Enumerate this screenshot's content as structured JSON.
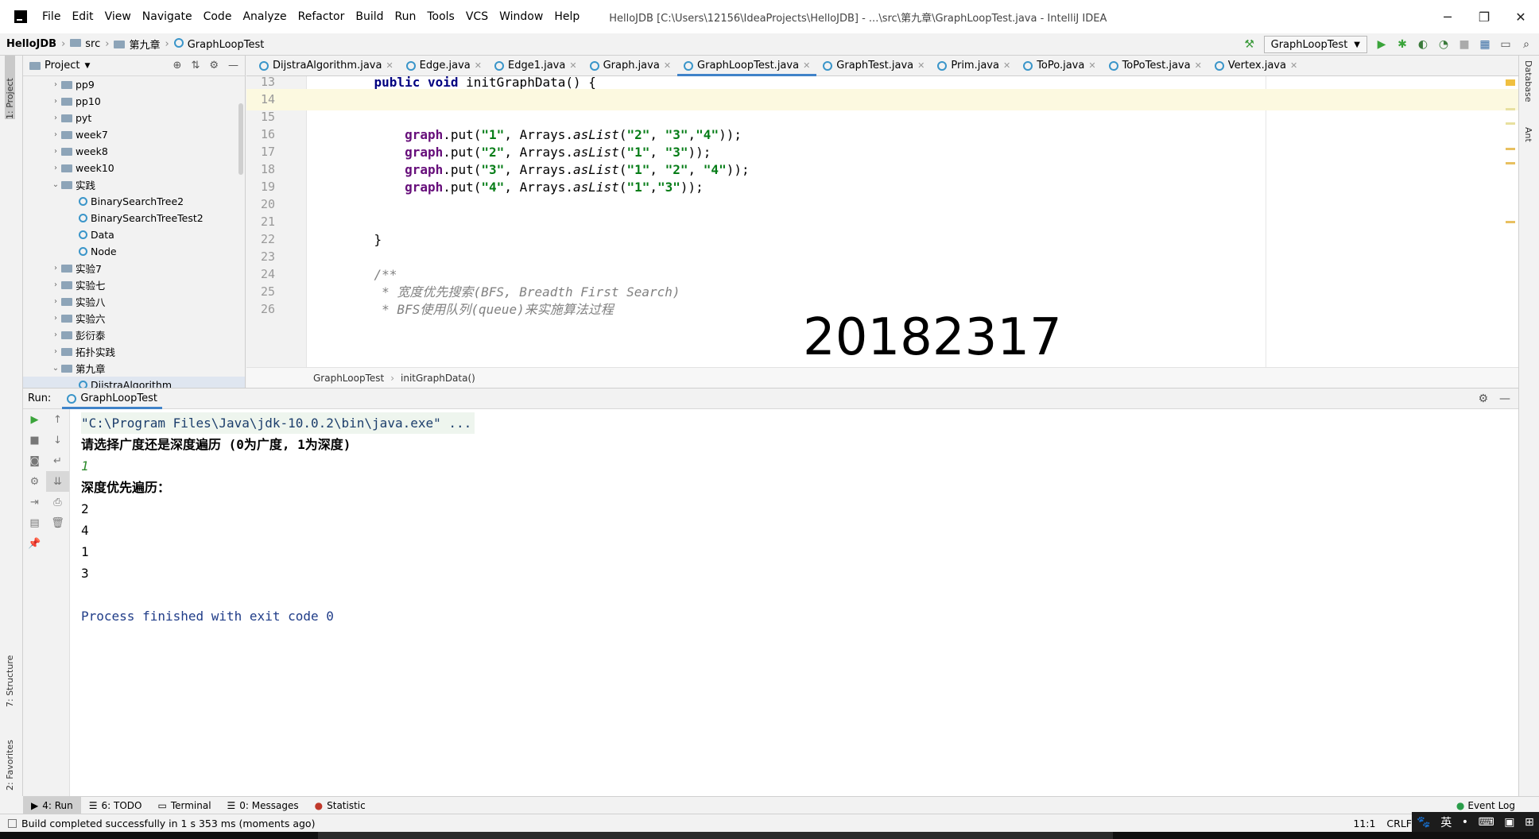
{
  "window": {
    "title": "HelloJDB [C:\\Users\\12156\\IdeaProjects\\HelloJDB] - ...\\src\\第九章\\GraphLoopTest.java - IntelliJ IDEA",
    "minimize": "─",
    "restore": "❐",
    "close": "✕"
  },
  "menu": [
    "File",
    "Edit",
    "View",
    "Navigate",
    "Code",
    "Analyze",
    "Refactor",
    "Build",
    "Run",
    "Tools",
    "VCS",
    "Window",
    "Help"
  ],
  "breadcrumb": [
    "HelloJDB",
    "src",
    "第九章",
    "GraphLoopTest"
  ],
  "run_config": "GraphLoopTest",
  "left_tabs": [
    "1: Project",
    "7: Structure",
    "2: Favorites"
  ],
  "right_tabs": [
    "Database",
    "Ant"
  ],
  "project_panel": {
    "title": "Project",
    "items": [
      {
        "label": "pp9",
        "kind": "folder",
        "expanded": false,
        "indent": 1
      },
      {
        "label": "pp10",
        "kind": "folder",
        "expanded": false,
        "indent": 1
      },
      {
        "label": "pyt",
        "kind": "folder",
        "expanded": false,
        "indent": 1
      },
      {
        "label": "week7",
        "kind": "folder",
        "expanded": false,
        "indent": 1
      },
      {
        "label": "week8",
        "kind": "folder",
        "expanded": false,
        "indent": 1
      },
      {
        "label": "week10",
        "kind": "folder",
        "expanded": false,
        "indent": 1
      },
      {
        "label": "实践",
        "kind": "folder",
        "expanded": true,
        "indent": 1
      },
      {
        "label": "BinarySearchTree2",
        "kind": "class",
        "indent": 2
      },
      {
        "label": "BinarySearchTreeTest2",
        "kind": "class",
        "indent": 2
      },
      {
        "label": "Data",
        "kind": "class",
        "indent": 2
      },
      {
        "label": "Node",
        "kind": "class",
        "indent": 2
      },
      {
        "label": "实验7",
        "kind": "folder",
        "expanded": false,
        "indent": 1
      },
      {
        "label": "实验七",
        "kind": "folder",
        "expanded": false,
        "indent": 1
      },
      {
        "label": "实验八",
        "kind": "folder",
        "expanded": false,
        "indent": 1
      },
      {
        "label": "实验六",
        "kind": "folder",
        "expanded": false,
        "indent": 1
      },
      {
        "label": "彭衍泰",
        "kind": "folder",
        "expanded": false,
        "indent": 1
      },
      {
        "label": "拓扑实践",
        "kind": "folder",
        "expanded": false,
        "indent": 1
      },
      {
        "label": "第九章",
        "kind": "folder",
        "expanded": true,
        "indent": 1
      },
      {
        "label": "DijstraAlgorithm",
        "kind": "class",
        "indent": 2
      }
    ]
  },
  "tabs": [
    {
      "label": "DijstraAlgorithm.java",
      "active": false
    },
    {
      "label": "Edge.java",
      "active": false
    },
    {
      "label": "Edge1.java",
      "active": false
    },
    {
      "label": "Graph.java",
      "active": false
    },
    {
      "label": "GraphLoopTest.java",
      "active": true
    },
    {
      "label": "GraphTest.java",
      "active": false
    },
    {
      "label": "Prim.java",
      "active": false
    },
    {
      "label": "ToPo.java",
      "active": false
    },
    {
      "label": "ToPoTest.java",
      "active": false
    },
    {
      "label": "Vertex.java",
      "active": false
    }
  ],
  "code_lines": [
    {
      "num": "13",
      "segments": [
        {
          "t": "    ",
          "c": ""
        },
        {
          "t": "public void ",
          "c": "kw"
        },
        {
          "t": "initGraphData() {",
          "c": ""
        }
      ]
    },
    {
      "num": "14",
      "current": true,
      "segments": []
    },
    {
      "num": "15",
      "segments": []
    },
    {
      "num": "16",
      "segments": [
        {
          "t": "        ",
          "c": ""
        },
        {
          "t": "graph",
          "c": "fld"
        },
        {
          "t": ".put(",
          "c": ""
        },
        {
          "t": "\"1\"",
          "c": "str"
        },
        {
          "t": ", Arrays.",
          "c": ""
        },
        {
          "t": "asList",
          "c": "it"
        },
        {
          "t": "(",
          "c": ""
        },
        {
          "t": "\"2\"",
          "c": "str"
        },
        {
          "t": ", ",
          "c": ""
        },
        {
          "t": "\"3\"",
          "c": "str"
        },
        {
          "t": ",",
          "c": ""
        },
        {
          "t": "\"4\"",
          "c": "str"
        },
        {
          "t": "));",
          "c": ""
        }
      ]
    },
    {
      "num": "17",
      "segments": [
        {
          "t": "        ",
          "c": ""
        },
        {
          "t": "graph",
          "c": "fld"
        },
        {
          "t": ".put(",
          "c": ""
        },
        {
          "t": "\"2\"",
          "c": "str"
        },
        {
          "t": ", Arrays.",
          "c": ""
        },
        {
          "t": "asList",
          "c": "it"
        },
        {
          "t": "(",
          "c": ""
        },
        {
          "t": "\"1\"",
          "c": "str"
        },
        {
          "t": ", ",
          "c": ""
        },
        {
          "t": "\"3\"",
          "c": "str"
        },
        {
          "t": "));",
          "c": ""
        }
      ]
    },
    {
      "num": "18",
      "segments": [
        {
          "t": "        ",
          "c": ""
        },
        {
          "t": "graph",
          "c": "fld"
        },
        {
          "t": ".put(",
          "c": ""
        },
        {
          "t": "\"3\"",
          "c": "str"
        },
        {
          "t": ", Arrays.",
          "c": ""
        },
        {
          "t": "asList",
          "c": "it"
        },
        {
          "t": "(",
          "c": ""
        },
        {
          "t": "\"1\"",
          "c": "str"
        },
        {
          "t": ", ",
          "c": ""
        },
        {
          "t": "\"2\"",
          "c": "str"
        },
        {
          "t": ", ",
          "c": ""
        },
        {
          "t": "\"4\"",
          "c": "str"
        },
        {
          "t": "));",
          "c": ""
        }
      ]
    },
    {
      "num": "19",
      "segments": [
        {
          "t": "        ",
          "c": ""
        },
        {
          "t": "graph",
          "c": "fld"
        },
        {
          "t": ".put(",
          "c": ""
        },
        {
          "t": "\"4\"",
          "c": "str"
        },
        {
          "t": ", Arrays.",
          "c": ""
        },
        {
          "t": "asList",
          "c": "it"
        },
        {
          "t": "(",
          "c": ""
        },
        {
          "t": "\"1\"",
          "c": "str"
        },
        {
          "t": ",",
          "c": ""
        },
        {
          "t": "\"3\"",
          "c": "str"
        },
        {
          "t": "));",
          "c": ""
        }
      ]
    },
    {
      "num": "20",
      "segments": []
    },
    {
      "num": "21",
      "segments": []
    },
    {
      "num": "22",
      "segments": [
        {
          "t": "    }",
          "c": ""
        }
      ]
    },
    {
      "num": "23",
      "segments": []
    },
    {
      "num": "24",
      "segments": [
        {
          "t": "    /**",
          "c": "cmt"
        }
      ]
    },
    {
      "num": "25",
      "segments": [
        {
          "t": "     * 宽度优先搜索(BFS, Breadth First Search)",
          "c": "cmt"
        }
      ]
    },
    {
      "num": "26",
      "segments": [
        {
          "t": "     * BFS使用队列(queue)来实施算法过程",
          "c": "cmt"
        }
      ]
    }
  ],
  "watermark": "20182317",
  "editor_breadcrumb": [
    "GraphLoopTest",
    "initGraphData()"
  ],
  "run": {
    "label": "Run:",
    "tab": "GraphLoopTest",
    "console": [
      {
        "text": "\"C:\\Program Files\\Java\\jdk-10.0.2\\bin\\java.exe\" ...",
        "style": "cmd"
      },
      {
        "text": "请选择广度还是深度遍历 (0为广度, 1为深度)",
        "style": "bold"
      },
      {
        "text": "1",
        "style": "input"
      },
      {
        "text": "深度优先遍历：",
        "style": "bold"
      },
      {
        "text": "2",
        "style": ""
      },
      {
        "text": "4",
        "style": ""
      },
      {
        "text": "1",
        "style": ""
      },
      {
        "text": "3",
        "style": ""
      },
      {
        "text": "",
        "style": ""
      },
      {
        "text": "Process finished with exit code 0",
        "style": "finish"
      }
    ]
  },
  "tool_windows": [
    "4: Run",
    "6: TODO",
    "Terminal",
    "0: Messages",
    "Statistic"
  ],
  "event_log": "Event Log",
  "status": {
    "message": "Build completed successfully in 1 s 353 ms (moments ago)",
    "position": "11:1",
    "line_sep": "CRLF"
  },
  "tray": [
    "🐾",
    "英",
    "•",
    "⌨",
    "▣",
    "⊞"
  ]
}
